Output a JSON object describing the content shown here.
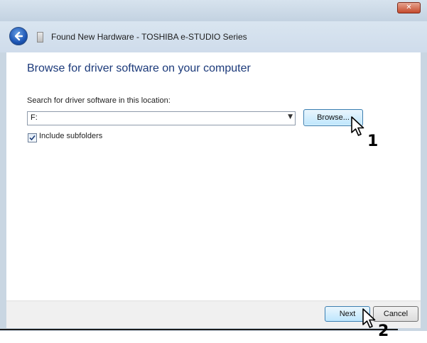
{
  "window": {
    "title": "Found New Hardware - TOSHIBA e-STUDIO Series",
    "close_label": "✕"
  },
  "main": {
    "heading": "Browse for driver software on your computer",
    "search_label": "Search for driver software in this location:",
    "location_value": "F:",
    "browse_label": "Browse...",
    "include_subfolders_label": "Include subfolders",
    "include_subfolders_checked": true
  },
  "footer": {
    "next_label": "Next",
    "cancel_label": "Cancel"
  },
  "callouts": {
    "step1": "1",
    "step2": "2"
  }
}
